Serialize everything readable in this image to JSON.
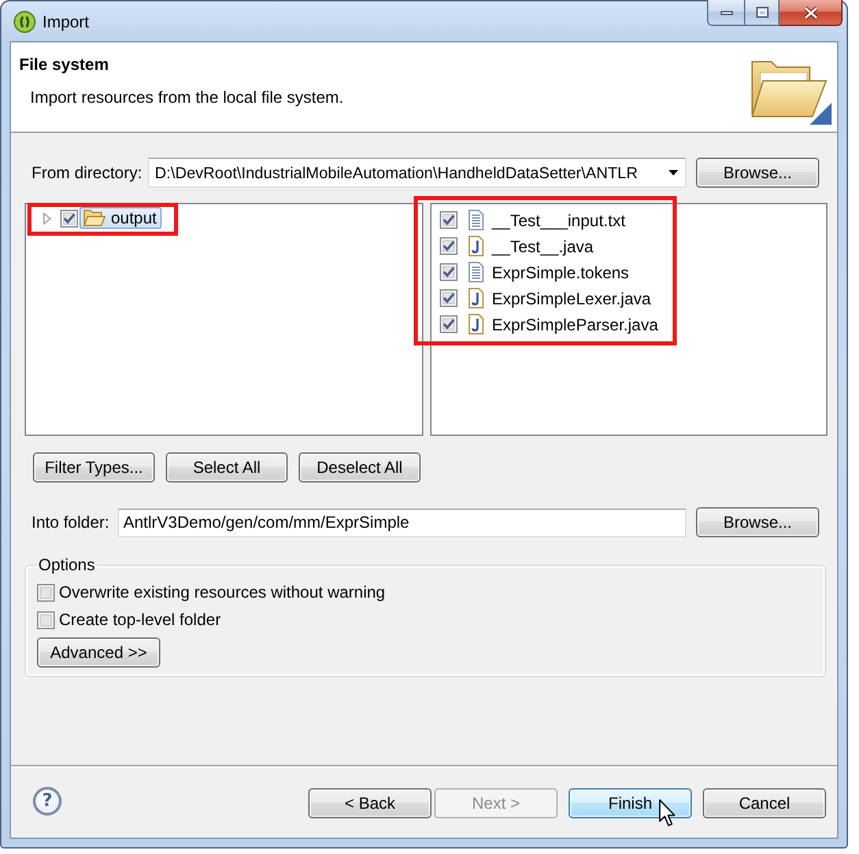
{
  "window": {
    "title": "Import"
  },
  "header": {
    "title": "File system",
    "description": "Import resources from the local file system."
  },
  "from_directory": {
    "label": "From directory:",
    "value": "D:\\DevRoot\\IndustrialMobileAutomation\\HandheldDataSetter\\ANTLR",
    "browse_button": "Browse..."
  },
  "folder_tree": {
    "highlighted": true,
    "items": [
      {
        "label": "output",
        "checked": true,
        "expanded": false,
        "selected": true
      }
    ]
  },
  "file_list": {
    "highlighted": true,
    "items": [
      {
        "name": "__Test___input.txt",
        "kind": "text",
        "checked": true
      },
      {
        "name": "__Test__.java",
        "kind": "java",
        "checked": true
      },
      {
        "name": "ExprSimple.tokens",
        "kind": "text",
        "checked": true
      },
      {
        "name": "ExprSimpleLexer.java",
        "kind": "java",
        "checked": true
      },
      {
        "name": "ExprSimpleParser.java",
        "kind": "java",
        "checked": true
      }
    ]
  },
  "selection_buttons": [
    "Filter Types...",
    "Select All",
    "Deselect All"
  ],
  "into_folder": {
    "label": "Into folder:",
    "value": "AntlrV3Demo/gen/com/mm/ExprSimple",
    "browse_button": "Browse..."
  },
  "options": {
    "title": "Options",
    "checkboxes": [
      {
        "label": "Overwrite existing resources without warning",
        "checked": false
      },
      {
        "label": "Create top-level folder",
        "checked": false
      }
    ],
    "advanced_button": "Advanced >>"
  },
  "help_button": {
    "symbol": "?"
  },
  "footer_buttons": [
    {
      "label": "< Back",
      "disabled": false,
      "hovered": false
    },
    {
      "label": "Next >",
      "disabled": true,
      "hovered": false
    },
    {
      "label": "Finish",
      "disabled": false,
      "hovered": true
    },
    {
      "label": "Cancel",
      "disabled": false,
      "hovered": false
    }
  ]
}
